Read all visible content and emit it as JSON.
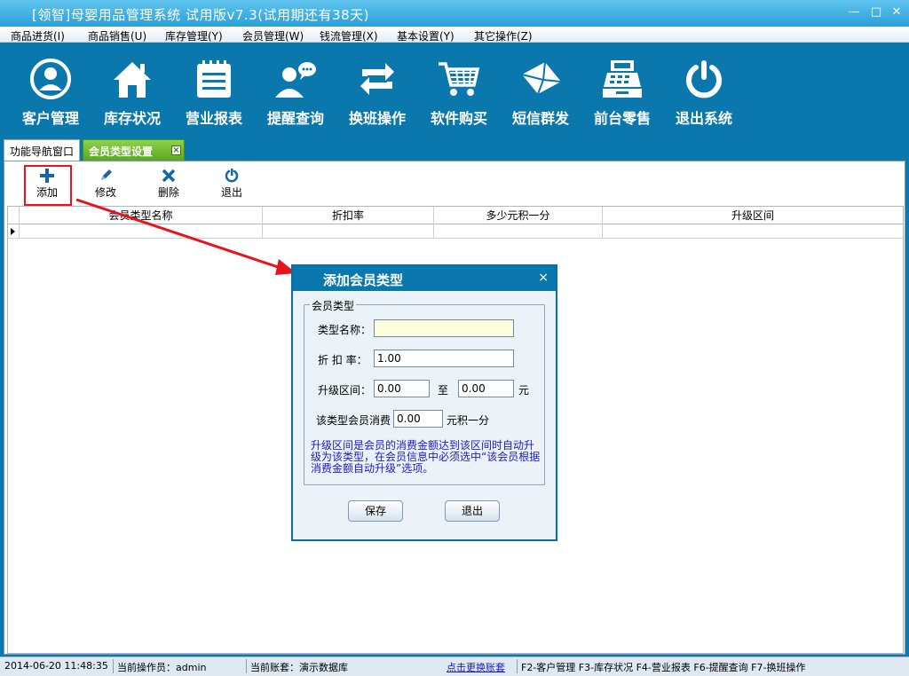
{
  "window": {
    "title": "[领智]母婴用品管理系统 试用版v7.3(试用期还有38天)"
  },
  "menu": [
    "商品进货(I)",
    "商品销售(U)",
    "库存管理(Y)",
    "会员管理(W)",
    "钱流管理(X)",
    "基本设置(Y)",
    "其它操作(Z)"
  ],
  "toolbar": [
    {
      "label": "客户管理",
      "icon": "customer-icon"
    },
    {
      "label": "库存状况",
      "icon": "home-icon"
    },
    {
      "label": "营业报表",
      "icon": "report-icon"
    },
    {
      "label": "提醒查询",
      "icon": "chat-person-icon"
    },
    {
      "label": "换班操作",
      "icon": "swap-icon"
    },
    {
      "label": "软件购买",
      "icon": "cart-icon"
    },
    {
      "label": "短信群发",
      "icon": "envelope-icon"
    },
    {
      "label": "前台零售",
      "icon": "register-icon"
    },
    {
      "label": "退出系统",
      "icon": "power-icon"
    }
  ],
  "tabs": {
    "nav": "功能导航窗口",
    "active": "会员类型设置",
    "close": "×"
  },
  "subtoolbar": {
    "add": "添加",
    "edit": "修改",
    "delete": "删除",
    "exit": "退出"
  },
  "grid": {
    "columns": [
      "会员类型名称",
      "折扣率",
      "多少元积一分",
      "升级区间"
    ]
  },
  "dialog": {
    "title": "添加会员类型",
    "close": "×",
    "group": "会员类型",
    "type_name_label": "类型名称：",
    "type_name_value": "",
    "discount_label": "折 扣 率：",
    "discount_value": "1.00",
    "upgrade_label": "升级区间：",
    "upgrade_from": "0.00",
    "upgrade_to_label": "至",
    "upgrade_to": "0.00",
    "upgrade_unit": "元",
    "points_label": "该类型会员消费",
    "points_value": "0.00",
    "points_suffix": "元积一分",
    "note": "升级区间是会员的消费金额达到该区间时自动升级为该类型，在会员信息中必须选中“该会员根据消费金额自动升级”选项。",
    "save": "保存",
    "exit": "退出"
  },
  "status": {
    "datetime": "2014-06-20 11:48:35",
    "operator": "当前操作员：admin",
    "account": "当前账套：演示数据库",
    "switch_link": "点击更换账套",
    "shortcuts": "F2-客户管理 F3-库存状况 F4-营业报表 F6-提醒查询 F7-换班操作"
  },
  "colors": {
    "toolbar_bg": "#0a77ad",
    "active_tab": "#5aa81e",
    "highlight": "#e8141b",
    "note_text": "#1a1ac8"
  }
}
